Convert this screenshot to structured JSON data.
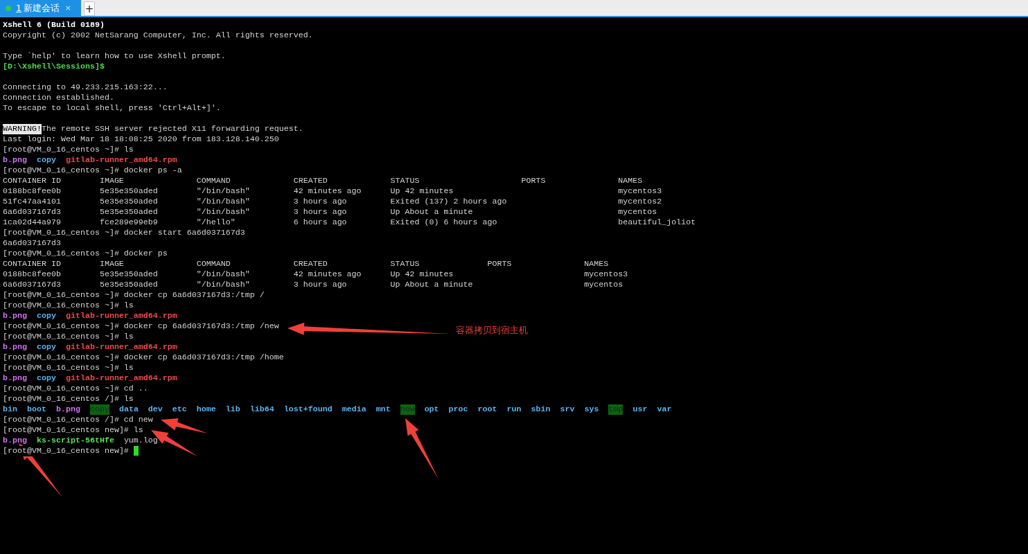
{
  "tabs": [
    {
      "number": "1",
      "title": "新建会话",
      "close": "×",
      "selected": true,
      "connected": true
    }
  ],
  "new_tab": "+",
  "terminal": [
    {
      "kind": "banner",
      "text": "Xshell 6 (Build 0189)"
    },
    {
      "kind": "output",
      "text": "Copyright (c) 2002 NetSarang Computer, Inc. All rights reserved."
    },
    {
      "kind": "blank"
    },
    {
      "kind": "output",
      "text": "Type `help' to learn how to use Xshell prompt."
    },
    {
      "kind": "local-prompt",
      "text": "[D:\\Xshell\\Sessions]$"
    },
    {
      "kind": "blank"
    },
    {
      "kind": "output",
      "text": "Connecting to 49.233.215.163:22..."
    },
    {
      "kind": "output",
      "text": "Connection established."
    },
    {
      "kind": "output",
      "text": "To escape to local shell, press 'Ctrl+Alt+]'."
    },
    {
      "kind": "blank"
    },
    {
      "kind": "warning",
      "badge": "WARNING!",
      "text": "The remote SSH server rejected X11 forwarding request."
    },
    {
      "kind": "output",
      "text": "Last login: Wed Mar 18 18:08:25 2020 from 183.128.140.250"
    },
    {
      "kind": "output",
      "text": "[root@VM_0_16_centos ~]# ls"
    },
    {
      "kind": "listing",
      "items": [
        {
          "name": "b.png",
          "kind": "image"
        },
        {
          "name": "copy",
          "kind": "dir"
        },
        {
          "name": "gitlab-runner_amd64.rpm",
          "kind": "archive"
        }
      ]
    },
    {
      "kind": "output",
      "text": "[root@VM_0_16_centos ~]# docker ps -a"
    },
    {
      "kind": "table",
      "columns": [
        "CONTAINER ID",
        "IMAGE",
        "COMMAND",
        "CREATED",
        "STATUS",
        "PORTS",
        "NAMES"
      ],
      "rows": [
        [
          "0188bc8fee0b",
          "5e35e350aded",
          "\"/bin/bash\"",
          "42 minutes ago",
          "Up 42 minutes",
          "",
          "mycentos3"
        ],
        [
          "51fc47aa4101",
          "5e35e350aded",
          "\"/bin/bash\"",
          "3 hours ago",
          "Exited (137) 2 hours ago",
          "",
          "mycentos2"
        ],
        [
          "6a6d037167d3",
          "5e35e350aded",
          "\"/bin/bash\"",
          "3 hours ago",
          "Up About a minute",
          "",
          "mycentos"
        ],
        [
          "1ca02d44a979",
          "fce289e99eb9",
          "\"/hello\"",
          "6 hours ago",
          "Exited (0) 6 hours ago",
          "",
          "beautiful_joliot"
        ]
      ]
    },
    {
      "kind": "output",
      "text": "[root@VM_0_16_centos ~]# docker start 6a6d037167d3"
    },
    {
      "kind": "output",
      "text": "6a6d037167d3"
    },
    {
      "kind": "output",
      "text": "[root@VM_0_16_centos ~]# docker ps"
    },
    {
      "kind": "table",
      "columns": [
        "CONTAINER ID",
        "IMAGE",
        "COMMAND",
        "CREATED",
        "STATUS",
        "PORTS",
        "NAMES"
      ],
      "rows": [
        [
          "0188bc8fee0b",
          "5e35e350aded",
          "\"/bin/bash\"",
          "42 minutes ago",
          "Up 42 minutes",
          "",
          "mycentos3"
        ],
        [
          "6a6d037167d3",
          "5e35e350aded",
          "\"/bin/bash\"",
          "3 hours ago",
          "Up About a minute",
          "",
          "mycentos"
        ]
      ]
    },
    {
      "kind": "output",
      "text": "[root@VM_0_16_centos ~]# docker cp 6a6d037167d3:/tmp /"
    },
    {
      "kind": "output",
      "text": "[root@VM_0_16_centos ~]# ls"
    },
    {
      "kind": "listing",
      "items": [
        {
          "name": "b.png",
          "kind": "image"
        },
        {
          "name": "copy",
          "kind": "dir"
        },
        {
          "name": "gitlab-runner_amd64.rpm",
          "kind": "archive"
        }
      ]
    },
    {
      "kind": "output",
      "text": "[root@VM_0_16_centos ~]# docker cp 6a6d037167d3:/tmp /new"
    },
    {
      "kind": "output",
      "text": "[root@VM_0_16_centos ~]# ls"
    },
    {
      "kind": "listing",
      "items": [
        {
          "name": "b.png",
          "kind": "image"
        },
        {
          "name": "copy",
          "kind": "dir"
        },
        {
          "name": "gitlab-runner_amd64.rpm",
          "kind": "archive"
        }
      ]
    },
    {
      "kind": "output",
      "text": "[root@VM_0_16_centos ~]# docker cp 6a6d037167d3:/tmp /home"
    },
    {
      "kind": "output",
      "text": "[root@VM_0_16_centos ~]# ls"
    },
    {
      "kind": "listing",
      "items": [
        {
          "name": "b.png",
          "kind": "image"
        },
        {
          "name": "copy",
          "kind": "dir"
        },
        {
          "name": "gitlab-runner_amd64.rpm",
          "kind": "archive"
        }
      ]
    },
    {
      "kind": "output",
      "text": "[root@VM_0_16_centos ~]# cd .."
    },
    {
      "kind": "output",
      "text": "[root@VM_0_16_centos /]# ls"
    },
    {
      "kind": "listing",
      "items": [
        {
          "name": "bin",
          "kind": "dir"
        },
        {
          "name": "boot",
          "kind": "dir"
        },
        {
          "name": "b.png",
          "kind": "image"
        },
        {
          "name": "copy",
          "kind": "sticky"
        },
        {
          "name": "data",
          "kind": "dir"
        },
        {
          "name": "dev",
          "kind": "dir"
        },
        {
          "name": "etc",
          "kind": "dir"
        },
        {
          "name": "home",
          "kind": "dir"
        },
        {
          "name": "lib",
          "kind": "dir"
        },
        {
          "name": "lib64",
          "kind": "dir"
        },
        {
          "name": "lost+found",
          "kind": "dir"
        },
        {
          "name": "media",
          "kind": "dir"
        },
        {
          "name": "mnt",
          "kind": "dir"
        },
        {
          "name": "new",
          "kind": "sticky"
        },
        {
          "name": "opt",
          "kind": "dir"
        },
        {
          "name": "proc",
          "kind": "dir"
        },
        {
          "name": "root",
          "kind": "dir"
        },
        {
          "name": "run",
          "kind": "dir"
        },
        {
          "name": "sbin",
          "kind": "dir"
        },
        {
          "name": "srv",
          "kind": "dir"
        },
        {
          "name": "sys",
          "kind": "dir"
        },
        {
          "name": "tmp",
          "kind": "sticky"
        },
        {
          "name": "usr",
          "kind": "dir"
        },
        {
          "name": "var",
          "kind": "dir"
        }
      ]
    },
    {
      "kind": "output",
      "text": "[root@VM_0_16_centos /]# cd new"
    },
    {
      "kind": "output",
      "text": "[root@VM_0_16_centos new]# ls"
    },
    {
      "kind": "listing",
      "items": [
        {
          "name": "b.png",
          "kind": "image"
        },
        {
          "name": "ks-script-56tHfe",
          "kind": "exec"
        },
        {
          "name": "yum.log",
          "kind": "file"
        }
      ]
    },
    {
      "kind": "output",
      "text": "[root@VM_0_16_centos new]#",
      "cursor": true
    }
  ],
  "annotation": "容器拷贝到宿主机"
}
